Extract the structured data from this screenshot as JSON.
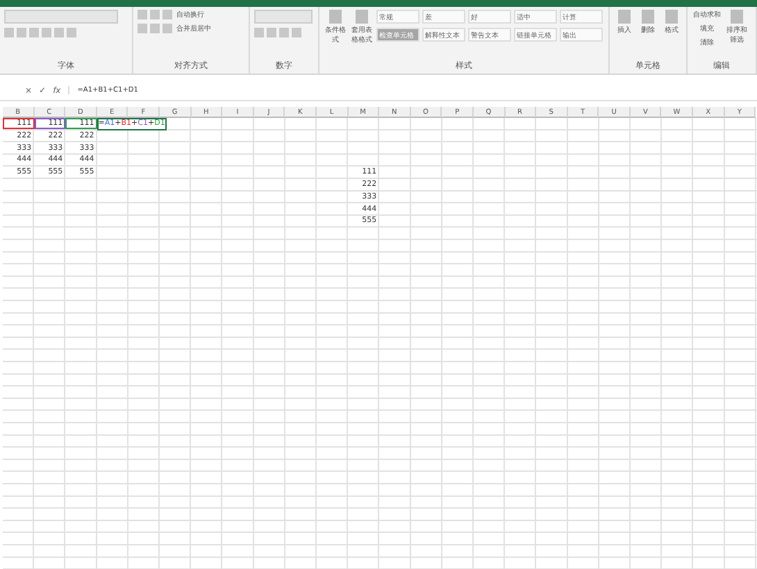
{
  "ribbon": {
    "groups": [
      {
        "label": "字体"
      },
      {
        "label": "对齐方式",
        "buttons": [
          "自动换行",
          "合并后居中"
        ]
      },
      {
        "label": "数字"
      },
      {
        "label": "样式",
        "buttons": [
          "条件格式",
          "套用表格格式"
        ],
        "styles": [
          "常规",
          "差",
          "好",
          "适中",
          "计算",
          "检查单元格",
          "解释性文本",
          "警告文本",
          "链接单元格",
          "输出"
        ]
      },
      {
        "label": "单元格",
        "buttons": [
          "插入",
          "删除",
          "格式"
        ]
      },
      {
        "label": "编辑",
        "buttons": [
          "自动求和",
          "填充",
          "清除",
          "排序和筛选"
        ]
      }
    ]
  },
  "formula_bar": {
    "cancel": "×",
    "enter": "✓",
    "fx": "fx",
    "value": "=A1+B1+C1+D1"
  },
  "grid": {
    "columns": [
      "B",
      "C",
      "D",
      "E",
      "F",
      "G",
      "H",
      "I",
      "J",
      "K",
      "L",
      "M",
      "N",
      "O",
      "P",
      "Q",
      "R",
      "S",
      "T",
      "U",
      "V",
      "W",
      "X",
      "Y"
    ],
    "rows": [
      [
        {
          "value": "111",
          "color": "#e0303a"
        },
        {
          "value": "111",
          "color": "#8a5cc7"
        },
        {
          "value": "111",
          "color": "#2e9e4f"
        },
        {
          "kind": "formula",
          "selected": true,
          "parts": [
            {
              "text": "=",
              "color": "#333333"
            },
            {
              "text": "A1",
              "color": "#3a6fd8"
            },
            {
              "text": "+",
              "color": "#333333"
            },
            {
              "text": "B1",
              "color": "#e0303a"
            },
            {
              "text": "+",
              "color": "#333333"
            },
            {
              "text": "C1",
              "color": "#8a5cc7"
            },
            {
              "text": "+",
              "color": "#333333"
            },
            {
              "text": "D1",
              "color": "#2e9e4f"
            }
          ]
        }
      ],
      [
        {
          "value": "222"
        },
        {
          "value": "222"
        },
        {
          "value": "222"
        }
      ],
      [
        {
          "value": "333"
        },
        {
          "value": "333"
        },
        {
          "value": "333"
        }
      ],
      [
        {
          "value": "444"
        },
        {
          "value": "444"
        },
        {
          "value": "444"
        }
      ],
      [
        {
          "value": "555"
        },
        {
          "value": "555"
        },
        {
          "value": "555"
        },
        null,
        null,
        null,
        null,
        null,
        null,
        null,
        null,
        {
          "value": "111"
        }
      ],
      [
        null,
        null,
        null,
        null,
        null,
        null,
        null,
        null,
        null,
        null,
        null,
        {
          "value": "222"
        }
      ],
      [
        null,
        null,
        null,
        null,
        null,
        null,
        null,
        null,
        null,
        null,
        null,
        {
          "value": "333"
        }
      ],
      [
        null,
        null,
        null,
        null,
        null,
        null,
        null,
        null,
        null,
        null,
        null,
        {
          "value": "444"
        }
      ],
      [
        null,
        null,
        null,
        null,
        null,
        null,
        null,
        null,
        null,
        null,
        null,
        {
          "value": "555"
        }
      ]
    ]
  }
}
